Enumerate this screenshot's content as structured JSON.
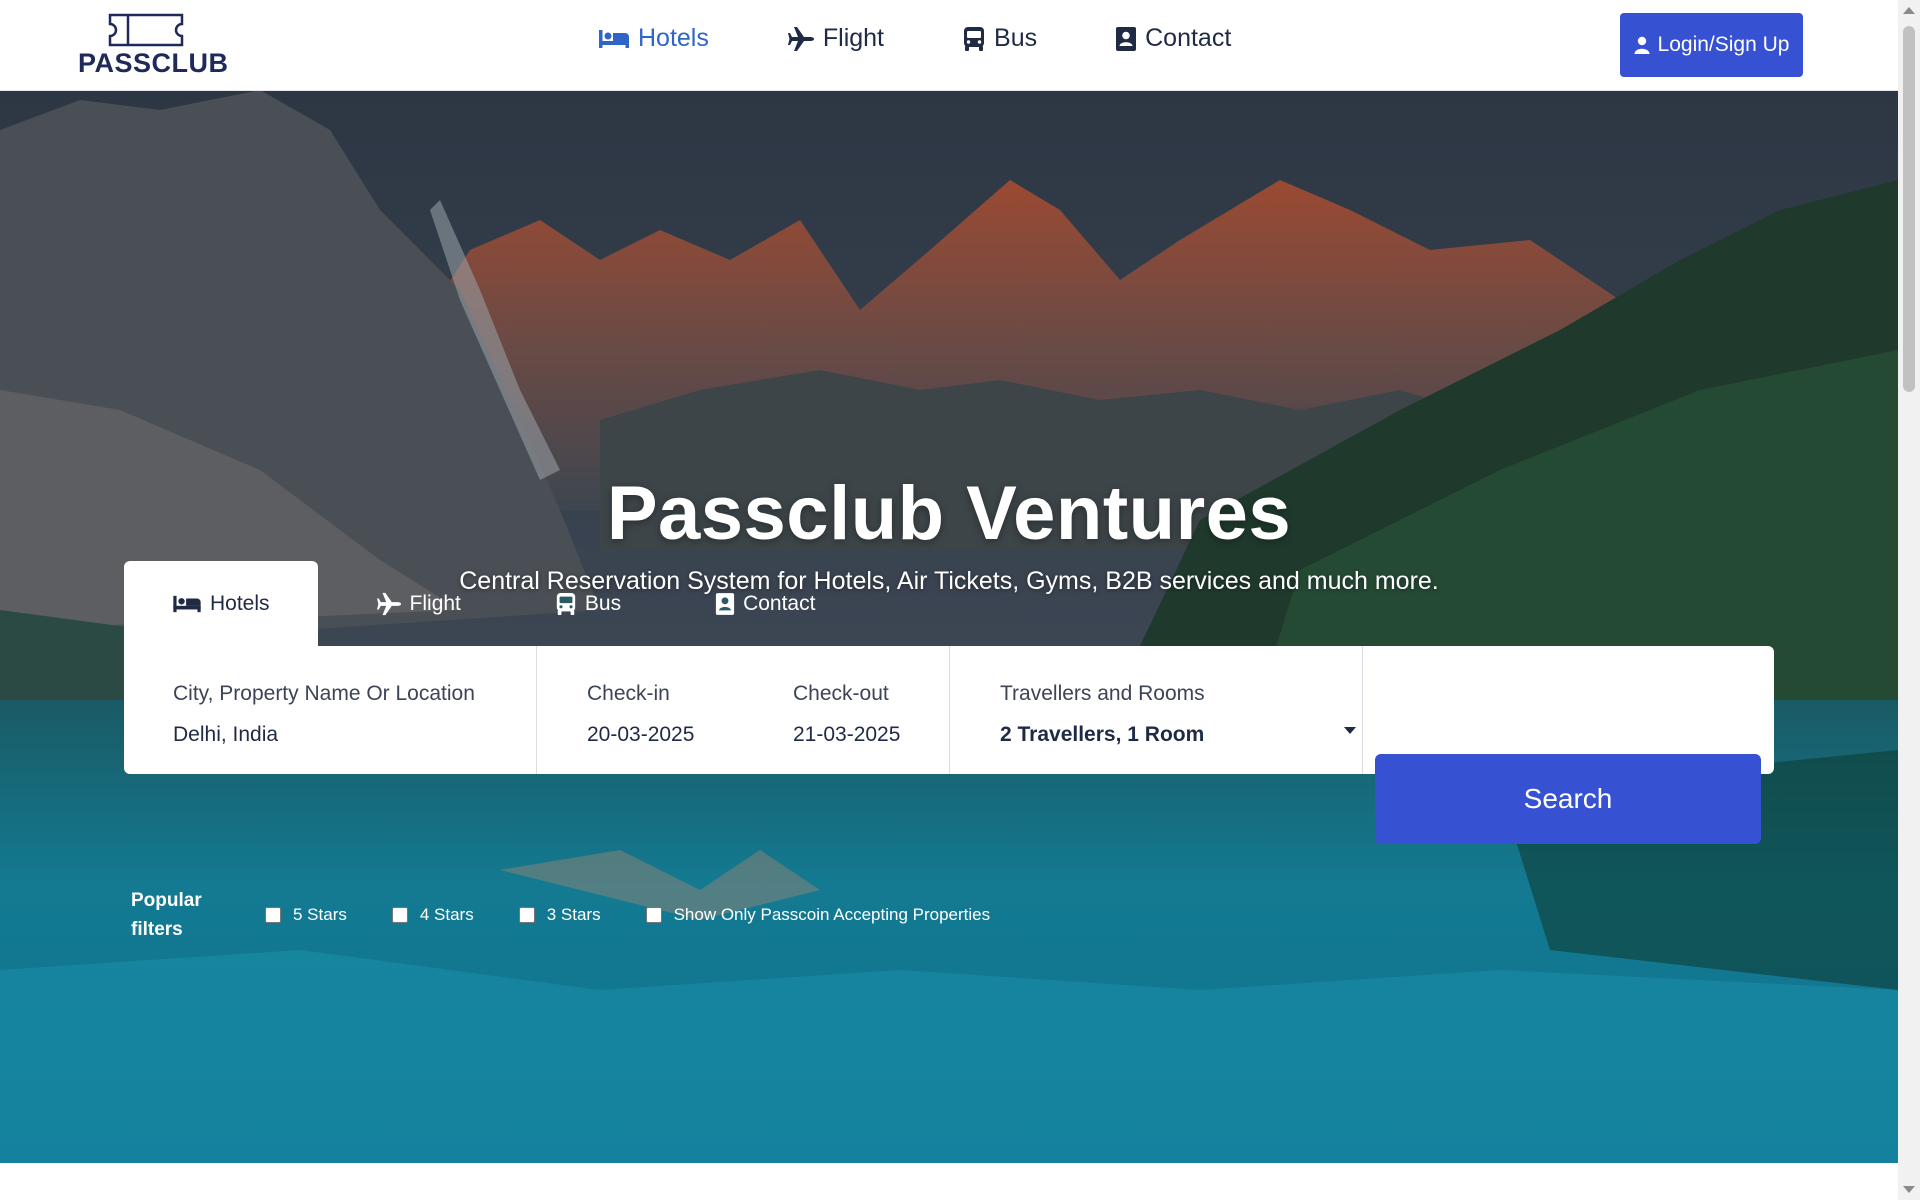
{
  "brand": {
    "name": "PASSCLUB"
  },
  "nav": {
    "items": [
      {
        "label": "Hotels",
        "icon": "bed-icon",
        "active": true
      },
      {
        "label": "Flight",
        "icon": "plane-icon",
        "active": false
      },
      {
        "label": "Bus",
        "icon": "bus-icon",
        "active": false
      },
      {
        "label": "Contact",
        "icon": "contact-icon",
        "active": false
      }
    ],
    "login_label": "Login/Sign Up"
  },
  "hero": {
    "title": "Passclub Ventures",
    "subtitle": "Central Reservation System for Hotels, Air Tickets, Gyms, B2B services and much more."
  },
  "search": {
    "tabs": [
      {
        "label": "Hotels",
        "icon": "bed-icon",
        "active": true
      },
      {
        "label": "Flight",
        "icon": "plane-icon",
        "active": false
      },
      {
        "label": "Bus",
        "icon": "bus-icon",
        "active": false
      },
      {
        "label": "Contact",
        "icon": "contact-icon",
        "active": false
      }
    ],
    "location": {
      "label": "City, Property Name Or Location",
      "value": "Delhi, India"
    },
    "checkin": {
      "label": "Check-in",
      "value": "20-03-2025"
    },
    "checkout": {
      "label": "Check-out",
      "value": "21-03-2025"
    },
    "travellers": {
      "label": "Travellers and Rooms",
      "value": "2 Travellers, 1 Room"
    },
    "button_label": "Search"
  },
  "filters": {
    "label": "Popular filters",
    "options": [
      {
        "label": "5 Stars",
        "checked": false
      },
      {
        "label": "4 Stars",
        "checked": false
      },
      {
        "label": "3 Stars",
        "checked": false
      },
      {
        "label": "Show Only Passcoin Accepting Properties",
        "checked": false
      }
    ]
  },
  "colors": {
    "accent": "#3651d2",
    "nav_active": "#2f64c8",
    "text_dark": "#1f2a44"
  }
}
